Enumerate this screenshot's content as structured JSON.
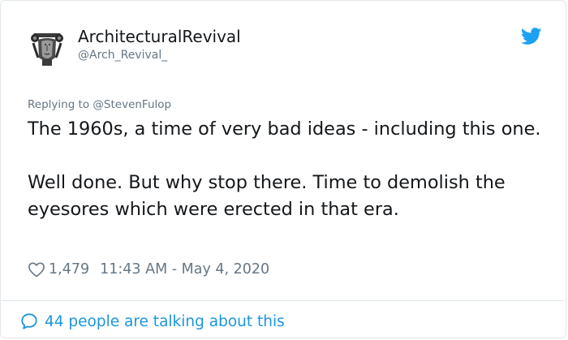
{
  "author": {
    "display_name": "ArchitecturalRevival",
    "handle": "@Arch_Revival_"
  },
  "reply_context": {
    "prefix": "Replying to",
    "mention": "@StevenFulop"
  },
  "tweet": {
    "paragraph_1": "The 1960s, a time of very bad ideas - including this one.",
    "paragraph_2": "Well done. But why stop there. Time to demolish the eyesores which were erected in that era."
  },
  "meta": {
    "likes": "1,479",
    "timestamp": "11:43 AM - May 4, 2020"
  },
  "footer": {
    "conversation_label": "44 people are talking about this"
  },
  "colors": {
    "twitter_blue": "#1da1f2",
    "link_blue": "#1b95e0",
    "text": "#14171a",
    "muted": "#657786",
    "border": "#e1e8ed"
  },
  "icons": [
    "avatar-janus-sculpture",
    "twitter-bird-icon",
    "heart-icon",
    "speech-bubble-icon"
  ]
}
